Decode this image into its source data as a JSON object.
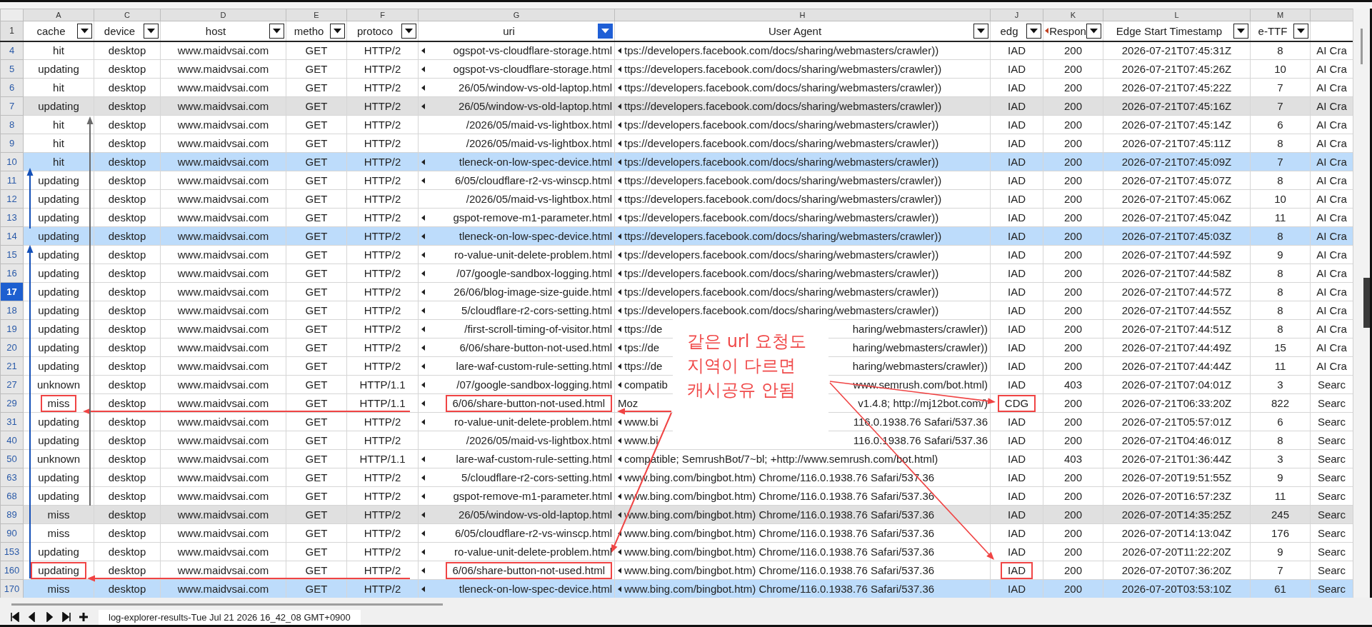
{
  "header_row_number": "1",
  "columns": [
    {
      "letter": "A",
      "label": "cache",
      "filter": true,
      "filtered": false,
      "overflow": false
    },
    {
      "letter": "C",
      "label": "device",
      "filter": true,
      "filtered": false,
      "overflow": false
    },
    {
      "letter": "D",
      "label": "host",
      "filter": true,
      "filtered": false,
      "overflow": false
    },
    {
      "letter": "E",
      "label": "metho",
      "filter": true,
      "filtered": false,
      "overflow": false
    },
    {
      "letter": "F",
      "label": "protoco",
      "filter": true,
      "filtered": false,
      "overflow": false
    },
    {
      "letter": "G",
      "label": "uri",
      "filter": true,
      "filtered": true,
      "overflow": false
    },
    {
      "letter": "H",
      "label": "User Agent",
      "filter": true,
      "filtered": false,
      "overflow": false
    },
    {
      "letter": "J",
      "label": "edg",
      "filter": true,
      "filtered": false,
      "overflow": false
    },
    {
      "letter": "K",
      "label": "Respon",
      "filter": true,
      "filtered": false,
      "overflow": true
    },
    {
      "letter": "L",
      "label": "Edge Start Timestamp",
      "filter": true,
      "filtered": false,
      "overflow": false
    },
    {
      "letter": "M",
      "label": "e-TTF",
      "filter": true,
      "filtered": false,
      "overflow": false
    },
    {
      "filter": false,
      "overflow": false
    }
  ],
  "rows": [
    {
      "number": "4",
      "cache": "hit",
      "device": "desktop",
      "host": "www.maidvsai.com",
      "method": "GET",
      "protocol": "HTTP/2",
      "uri": "ogspot-vs-cloudflare-storage.html",
      "uri_overflow": true,
      "user_agent": "tps://developers.facebook.com/docs/sharing/webmasters/crawler))",
      "ua_overflow": true,
      "edge": "IAD",
      "response": "200",
      "timestamp": "2026-07-21T07:45:31Z",
      "ttfb": "8",
      "column_13": "AI Cra",
      "selected": false,
      "marked": false,
      "active": false
    },
    {
      "number": "5",
      "cache": "updating",
      "device": "desktop",
      "host": "www.maidvsai.com",
      "method": "GET",
      "protocol": "HTTP/2",
      "uri": "ogspot-vs-cloudflare-storage.html",
      "uri_overflow": true,
      "user_agent": "ttps://developers.facebook.com/docs/sharing/webmasters/crawler))",
      "ua_overflow": true,
      "edge": "IAD",
      "response": "200",
      "timestamp": "2026-07-21T07:45:26Z",
      "ttfb": "10",
      "column_13": "AI Cra",
      "selected": false,
      "marked": false,
      "active": false
    },
    {
      "number": "6",
      "cache": "hit",
      "device": "desktop",
      "host": "www.maidvsai.com",
      "method": "GET",
      "protocol": "HTTP/2",
      "uri": "26/05/window-vs-old-laptop.html",
      "uri_overflow": true,
      "user_agent": "ttps://developers.facebook.com/docs/sharing/webmasters/crawler))",
      "ua_overflow": true,
      "edge": "IAD",
      "response": "200",
      "timestamp": "2026-07-21T07:45:22Z",
      "ttfb": "7",
      "column_13": "AI Cra",
      "selected": false,
      "marked": false,
      "active": false
    },
    {
      "number": "7",
      "cache": "updating",
      "device": "desktop",
      "host": "www.maidvsai.com",
      "method": "GET",
      "protocol": "HTTP/2",
      "uri": "26/05/window-vs-old-laptop.html",
      "uri_overflow": true,
      "user_agent": "ttps://developers.facebook.com/docs/sharing/webmasters/crawler))",
      "ua_overflow": true,
      "edge": "IAD",
      "response": "200",
      "timestamp": "2026-07-21T07:45:16Z",
      "ttfb": "7",
      "column_13": "AI Cra",
      "selected": false,
      "marked": true,
      "active": false
    },
    {
      "number": "8",
      "cache": "hit",
      "device": "desktop",
      "host": "www.maidvsai.com",
      "method": "GET",
      "protocol": "HTTP/2",
      "uri": "/2026/05/maid-vs-lightbox.html",
      "uri_overflow": false,
      "user_agent": "tps://developers.facebook.com/docs/sharing/webmasters/crawler))",
      "ua_overflow": true,
      "edge": "IAD",
      "response": "200",
      "timestamp": "2026-07-21T07:45:14Z",
      "ttfb": "6",
      "column_13": "AI Cra",
      "selected": false,
      "marked": false,
      "active": false
    },
    {
      "number": "9",
      "cache": "hit",
      "device": "desktop",
      "host": "www.maidvsai.com",
      "method": "GET",
      "protocol": "HTTP/2",
      "uri": "/2026/05/maid-vs-lightbox.html",
      "uri_overflow": false,
      "user_agent": "tps://developers.facebook.com/docs/sharing/webmasters/crawler))",
      "ua_overflow": true,
      "edge": "IAD",
      "response": "200",
      "timestamp": "2026-07-21T07:45:11Z",
      "ttfb": "8",
      "column_13": "AI Cra",
      "selected": false,
      "marked": false,
      "active": false
    },
    {
      "number": "10",
      "cache": "hit",
      "device": "desktop",
      "host": "www.maidvsai.com",
      "method": "GET",
      "protocol": "HTTP/2",
      "uri": "tleneck-on-low-spec-device.html",
      "uri_overflow": true,
      "user_agent": "tps://developers.facebook.com/docs/sharing/webmasters/crawler))",
      "ua_overflow": true,
      "edge": "IAD",
      "response": "200",
      "timestamp": "2026-07-21T07:45:09Z",
      "ttfb": "7",
      "column_13": "AI Cra",
      "selected": true,
      "marked": false,
      "active": false
    },
    {
      "number": "11",
      "cache": "updating",
      "device": "desktop",
      "host": "www.maidvsai.com",
      "method": "GET",
      "protocol": "HTTP/2",
      "uri": "6/05/cloudflare-r2-vs-winscp.html",
      "uri_overflow": true,
      "user_agent": "ttps://developers.facebook.com/docs/sharing/webmasters/crawler))",
      "ua_overflow": true,
      "edge": "IAD",
      "response": "200",
      "timestamp": "2026-07-21T07:45:07Z",
      "ttfb": "8",
      "column_13": "AI Cra",
      "selected": false,
      "marked": false,
      "active": false
    },
    {
      "number": "12",
      "cache": "updating",
      "device": "desktop",
      "host": "www.maidvsai.com",
      "method": "GET",
      "protocol": "HTTP/2",
      "uri": "/2026/05/maid-vs-lightbox.html",
      "uri_overflow": false,
      "user_agent": "ttps://developers.facebook.com/docs/sharing/webmasters/crawler))",
      "ua_overflow": true,
      "edge": "IAD",
      "response": "200",
      "timestamp": "2026-07-21T07:45:06Z",
      "ttfb": "10",
      "column_13": "AI Cra",
      "selected": false,
      "marked": false,
      "active": false
    },
    {
      "number": "13",
      "cache": "updating",
      "device": "desktop",
      "host": "www.maidvsai.com",
      "method": "GET",
      "protocol": "HTTP/2",
      "uri": "gspot-remove-m1-parameter.html",
      "uri_overflow": true,
      "user_agent": "tps://developers.facebook.com/docs/sharing/webmasters/crawler))",
      "ua_overflow": true,
      "edge": "IAD",
      "response": "200",
      "timestamp": "2026-07-21T07:45:04Z",
      "ttfb": "11",
      "column_13": "AI Cra",
      "selected": false,
      "marked": false,
      "active": false
    },
    {
      "number": "14",
      "cache": "updating",
      "device": "desktop",
      "host": "www.maidvsai.com",
      "method": "GET",
      "protocol": "HTTP/2",
      "uri": "tleneck-on-low-spec-device.html",
      "uri_overflow": true,
      "user_agent": "ttps://developers.facebook.com/docs/sharing/webmasters/crawler))",
      "ua_overflow": true,
      "edge": "IAD",
      "response": "200",
      "timestamp": "2026-07-21T07:45:03Z",
      "ttfb": "8",
      "column_13": "AI Cra",
      "selected": true,
      "marked": false,
      "active": false
    },
    {
      "number": "15",
      "cache": "updating",
      "device": "desktop",
      "host": "www.maidvsai.com",
      "method": "GET",
      "protocol": "HTTP/2",
      "uri": "ro-value-unit-delete-problem.html",
      "uri_overflow": true,
      "user_agent": "tps://developers.facebook.com/docs/sharing/webmasters/crawler))",
      "ua_overflow": true,
      "edge": "IAD",
      "response": "200",
      "timestamp": "2026-07-21T07:44:59Z",
      "ttfb": "9",
      "column_13": "AI Cra",
      "selected": false,
      "marked": false,
      "active": false
    },
    {
      "number": "16",
      "cache": "updating",
      "device": "desktop",
      "host": "www.maidvsai.com",
      "method": "GET",
      "protocol": "HTTP/2",
      "uri": "/07/google-sandbox-logging.html",
      "uri_overflow": true,
      "user_agent": "tps://developers.facebook.com/docs/sharing/webmasters/crawler))",
      "ua_overflow": true,
      "edge": "IAD",
      "response": "200",
      "timestamp": "2026-07-21T07:44:58Z",
      "ttfb": "8",
      "column_13": "AI Cra",
      "selected": false,
      "marked": false,
      "active": false
    },
    {
      "number": "17",
      "cache": "updating",
      "device": "desktop",
      "host": "www.maidvsai.com",
      "method": "GET",
      "protocol": "HTTP/2",
      "uri": "26/06/blog-image-size-guide.html",
      "uri_overflow": true,
      "user_agent": "tps://developers.facebook.com/docs/sharing/webmasters/crawler))",
      "ua_overflow": true,
      "edge": "IAD",
      "response": "200",
      "timestamp": "2026-07-21T07:44:57Z",
      "ttfb": "8",
      "column_13": "AI Cra",
      "selected": false,
      "marked": false,
      "active": true
    },
    {
      "number": "18",
      "cache": "updating",
      "device": "desktop",
      "host": "www.maidvsai.com",
      "method": "GET",
      "protocol": "HTTP/2",
      "uri": "5/cloudflare-r2-cors-setting.html",
      "uri_overflow": true,
      "user_agent": "tps://developers.facebook.com/docs/sharing/webmasters/crawler))",
      "ua_overflow": true,
      "edge": "IAD",
      "response": "200",
      "timestamp": "2026-07-21T07:44:55Z",
      "ttfb": "8",
      "column_13": "AI Cra",
      "selected": false,
      "marked": false,
      "active": false
    },
    {
      "number": "19",
      "cache": "updating",
      "device": "desktop",
      "host": "www.maidvsai.com",
      "method": "GET",
      "protocol": "HTTP/2",
      "uri": "/first-scroll-timing-of-visitor.html",
      "uri_overflow": true,
      "user_agent": "ttps://de",
      "user_agent_end": "haring/webmasters/crawler))",
      "ua_overflow": true,
      "edge": "IAD",
      "response": "200",
      "timestamp": "2026-07-21T07:44:51Z",
      "ttfb": "8",
      "column_13": "AI Cra",
      "selected": false,
      "marked": false,
      "active": false
    },
    {
      "number": "20",
      "cache": "updating",
      "device": "desktop",
      "host": "www.maidvsai.com",
      "method": "GET",
      "protocol": "HTTP/2",
      "uri": "6/06/share-button-not-used.html",
      "uri_overflow": true,
      "user_agent": "tps://de",
      "user_agent_end": "haring/webmasters/crawler))",
      "ua_overflow": true,
      "edge": "IAD",
      "response": "200",
      "timestamp": "2026-07-21T07:44:49Z",
      "ttfb": "15",
      "column_13": "AI Cra",
      "selected": false,
      "marked": false,
      "active": false
    },
    {
      "number": "21",
      "cache": "updating",
      "device": "desktop",
      "host": "www.maidvsai.com",
      "method": "GET",
      "protocol": "HTTP/2",
      "uri": "lare-waf-custom-rule-setting.html",
      "uri_overflow": true,
      "user_agent": "ttps://de",
      "user_agent_end": "haring/webmasters/crawler))",
      "ua_overflow": true,
      "edge": "IAD",
      "response": "200",
      "timestamp": "2026-07-21T07:44:44Z",
      "ttfb": "11",
      "column_13": "AI Cra",
      "selected": false,
      "marked": false,
      "active": false
    },
    {
      "number": "27",
      "cache": "unknown",
      "device": "desktop",
      "host": "www.maidvsai.com",
      "method": "GET",
      "protocol": "HTTP/1.1",
      "uri": "/07/google-sandbox-logging.html",
      "uri_overflow": true,
      "user_agent": "compatib",
      "user_agent_end": "www.semrush.com/bot.html)",
      "ua_overflow": true,
      "edge": "IAD",
      "response": "403",
      "timestamp": "2026-07-21T07:04:01Z",
      "ttfb": "3",
      "column_13": "Searc",
      "selected": false,
      "marked": false,
      "active": false
    },
    {
      "number": "29",
      "cache": "miss",
      "device": "desktop",
      "host": "www.maidvsai.com",
      "method": "GET",
      "protocol": "HTTP/1.1",
      "uri": "6/06/share-button-not-used.html",
      "uri_overflow": true,
      "user_agent": "Moz",
      "user_agent_end": "v1.4.8; http://mj12bot.com/)",
      "ua_overflow": false,
      "edge": "CDG",
      "response": "200",
      "timestamp": "2026-07-21T06:33:20Z",
      "ttfb": "822",
      "column_13": "Searc",
      "selected": false,
      "marked": false,
      "active": false,
      "boxed": true
    },
    {
      "number": "31",
      "cache": "updating",
      "device": "desktop",
      "host": "www.maidvsai.com",
      "method": "GET",
      "protocol": "HTTP/2",
      "uri": "ro-value-unit-delete-problem.html",
      "uri_overflow": true,
      "user_agent": "www.bi",
      "user_agent_end": "116.0.1938.76 Safari/537.36",
      "ua_overflow": true,
      "edge": "IAD",
      "response": "200",
      "timestamp": "2026-07-21T05:57:01Z",
      "ttfb": "6",
      "column_13": "Searc",
      "selected": false,
      "marked": false,
      "active": false
    },
    {
      "number": "40",
      "cache": "updating",
      "device": "desktop",
      "host": "www.maidvsai.com",
      "method": "GET",
      "protocol": "HTTP/2",
      "uri": "/2026/05/maid-vs-lightbox.html",
      "uri_overflow": false,
      "user_agent": "www.bi",
      "user_agent_end": "116.0.1938.76 Safari/537.36",
      "ua_overflow": true,
      "edge": "IAD",
      "response": "200",
      "timestamp": "2026-07-21T04:46:01Z",
      "ttfb": "8",
      "column_13": "Searc",
      "selected": false,
      "marked": false,
      "active": false
    },
    {
      "number": "50",
      "cache": "unknown",
      "device": "desktop",
      "host": "www.maidvsai.com",
      "method": "GET",
      "protocol": "HTTP/1.1",
      "uri": "lare-waf-custom-rule-setting.html",
      "uri_overflow": true,
      "user_agent": "compatible; SemrushBot/7~bl; +http://www.semrush.com/bot.html)",
      "ua_overflow": true,
      "edge": "IAD",
      "response": "403",
      "timestamp": "2026-07-21T01:36:44Z",
      "ttfb": "3",
      "column_13": "Searc",
      "selected": false,
      "marked": false,
      "active": false
    },
    {
      "number": "63",
      "cache": "updating",
      "device": "desktop",
      "host": "www.maidvsai.com",
      "method": "GET",
      "protocol": "HTTP/2",
      "uri": "5/cloudflare-r2-cors-setting.html",
      "uri_overflow": true,
      "user_agent": "www.bing.com/bingbot.htm) Chrome/116.0.1938.76 Safari/537.36",
      "ua_overflow": true,
      "edge": "IAD",
      "response": "200",
      "timestamp": "2026-07-20T19:51:55Z",
      "ttfb": "9",
      "column_13": "Searc",
      "selected": false,
      "marked": false,
      "active": false
    },
    {
      "number": "68",
      "cache": "updating",
      "device": "desktop",
      "host": "www.maidvsai.com",
      "method": "GET",
      "protocol": "HTTP/2",
      "uri": "gspot-remove-m1-parameter.html",
      "uri_overflow": true,
      "user_agent": "www.bing.com/bingbot.htm) Chrome/116.0.1938.76 Safari/537.36",
      "ua_overflow": true,
      "edge": "IAD",
      "response": "200",
      "timestamp": "2026-07-20T16:57:23Z",
      "ttfb": "11",
      "column_13": "Searc",
      "selected": false,
      "marked": false,
      "active": false
    },
    {
      "number": "89",
      "cache": "miss",
      "device": "desktop",
      "host": "www.maidvsai.com",
      "method": "GET",
      "protocol": "HTTP/2",
      "uri": "26/05/window-vs-old-laptop.html",
      "uri_overflow": true,
      "user_agent": "www.bing.com/bingbot.htm) Chrome/116.0.1938.76 Safari/537.36",
      "ua_overflow": true,
      "edge": "IAD",
      "response": "200",
      "timestamp": "2026-07-20T14:35:25Z",
      "ttfb": "245",
      "column_13": "Searc",
      "selected": false,
      "marked": true,
      "active": false
    },
    {
      "number": "90",
      "cache": "miss",
      "device": "desktop",
      "host": "www.maidvsai.com",
      "method": "GET",
      "protocol": "HTTP/2",
      "uri": "6/05/cloudflare-r2-vs-winscp.html",
      "uri_overflow": true,
      "user_agent": "www.bing.com/bingbot.htm) Chrome/116.0.1938.76 Safari/537.36",
      "ua_overflow": true,
      "edge": "IAD",
      "response": "200",
      "timestamp": "2026-07-20T14:13:04Z",
      "ttfb": "176",
      "column_13": "Searc",
      "selected": false,
      "marked": false,
      "active": false
    },
    {
      "number": "153",
      "cache": "updating",
      "device": "desktop",
      "host": "www.maidvsai.com",
      "method": "GET",
      "protocol": "HTTP/2",
      "uri": "ro-value-unit-delete-problem.html",
      "uri_overflow": true,
      "user_agent": "www.bing.com/bingbot.htm) Chrome/116.0.1938.76 Safari/537.36",
      "ua_overflow": true,
      "edge": "IAD",
      "response": "200",
      "timestamp": "2026-07-20T11:22:20Z",
      "ttfb": "9",
      "column_13": "Searc",
      "selected": false,
      "marked": false,
      "active": false
    },
    {
      "number": "160",
      "cache": "updating",
      "device": "desktop",
      "host": "www.maidvsai.com",
      "method": "GET",
      "protocol": "HTTP/2",
      "uri": "6/06/share-button-not-used.html",
      "uri_overflow": true,
      "user_agent": "www.bing.com/bingbot.htm) Chrome/116.0.1938.76 Safari/537.36",
      "ua_overflow": true,
      "edge": "IAD",
      "response": "200",
      "timestamp": "2026-07-20T07:36:20Z",
      "ttfb": "7",
      "column_13": "Searc",
      "selected": false,
      "marked": false,
      "active": false,
      "boxed": true
    },
    {
      "number": "170",
      "cache": "miss",
      "device": "desktop",
      "host": "www.maidvsai.com",
      "method": "GET",
      "protocol": "HTTP/2",
      "uri": "tleneck-on-low-spec-device.html",
      "uri_overflow": true,
      "user_agent": "www.bing.com/bingbot.htm) Chrome/116.0.1938.76 Safari/537.36",
      "ua_overflow": true,
      "edge": "IAD",
      "response": "200",
      "timestamp": "2026-07-20T03:53:10Z",
      "ttfb": "61",
      "column_13": "Searc",
      "selected": true,
      "marked": false,
      "active": false
    }
  ],
  "note": {
    "lines": [
      "같은 url 요청도",
      "지역이 다르면",
      "캐시공유 안됨"
    ]
  },
  "sheet_tabs": [
    {
      "label": "log-explorer-results-Tue Jul 21 2026 16_42_08 GMT+0900",
      "selected": true
    }
  ]
}
